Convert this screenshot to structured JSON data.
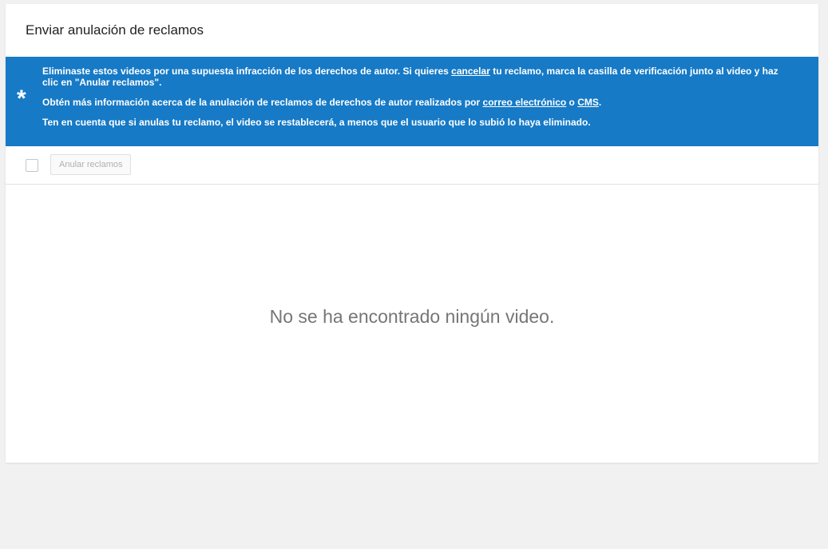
{
  "header": {
    "title": "Enviar anulación de reclamos"
  },
  "banner": {
    "icon": "asterisk-icon",
    "background_color": "#167ac6",
    "line1_part1": "Eliminaste estos videos por una supuesta infracción de los derechos de autor. Si quieres ",
    "line1_link": "cancelar",
    "line1_part2": " tu reclamo, marca la casilla de verificación junto al video y haz clic en \"Anular reclamos\".",
    "line2_part1": "Obtén más información acerca de la anulación de reclamos de derechos de autor realizados por ",
    "line2_link1": "correo electrónico",
    "line2_mid": " o ",
    "line2_link2": "CMS",
    "line2_end": ".",
    "line3": "Ten en cuenta que si anulas tu reclamo, el video se restablecerá, a menos que el usuario que lo subió lo haya eliminado."
  },
  "toolbar": {
    "select_all_checked": false,
    "anular_button_label": "Anular reclamos"
  },
  "empty_state": {
    "message": "No se ha encontrado ningún video."
  }
}
